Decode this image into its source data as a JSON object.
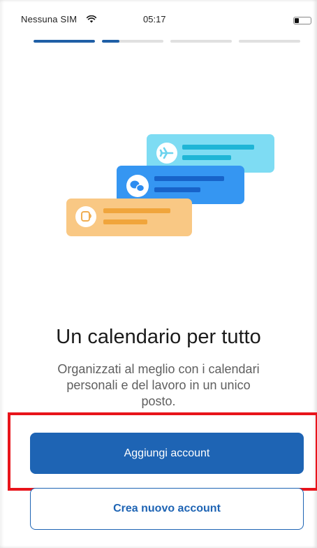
{
  "status_bar": {
    "carrier": "Nessuna SIM",
    "time": "05:17",
    "icons": [
      "wifi-icon",
      "battery-icon"
    ]
  },
  "progress": {
    "total_steps": 4,
    "current_step": 2,
    "current_step_fraction": 0.28
  },
  "illustration": {
    "cards": [
      {
        "icon": "airplane-icon",
        "color": "#6dd3ee"
      },
      {
        "icon": "chat-bubbles-icon",
        "color": "#2d8cf0"
      },
      {
        "icon": "coffee-cup-icon",
        "color": "#f8c176"
      }
    ]
  },
  "onboarding": {
    "title": "Un calendario per tutto",
    "subtitle": "Organizzati al meglio con i calendari personali e del lavoro in un unico posto."
  },
  "actions": {
    "add_account_label": "Aggiungi account",
    "create_account_label": "Crea nuovo account"
  },
  "colors": {
    "primary": "#1e64b4",
    "highlight": "#e8141b"
  }
}
